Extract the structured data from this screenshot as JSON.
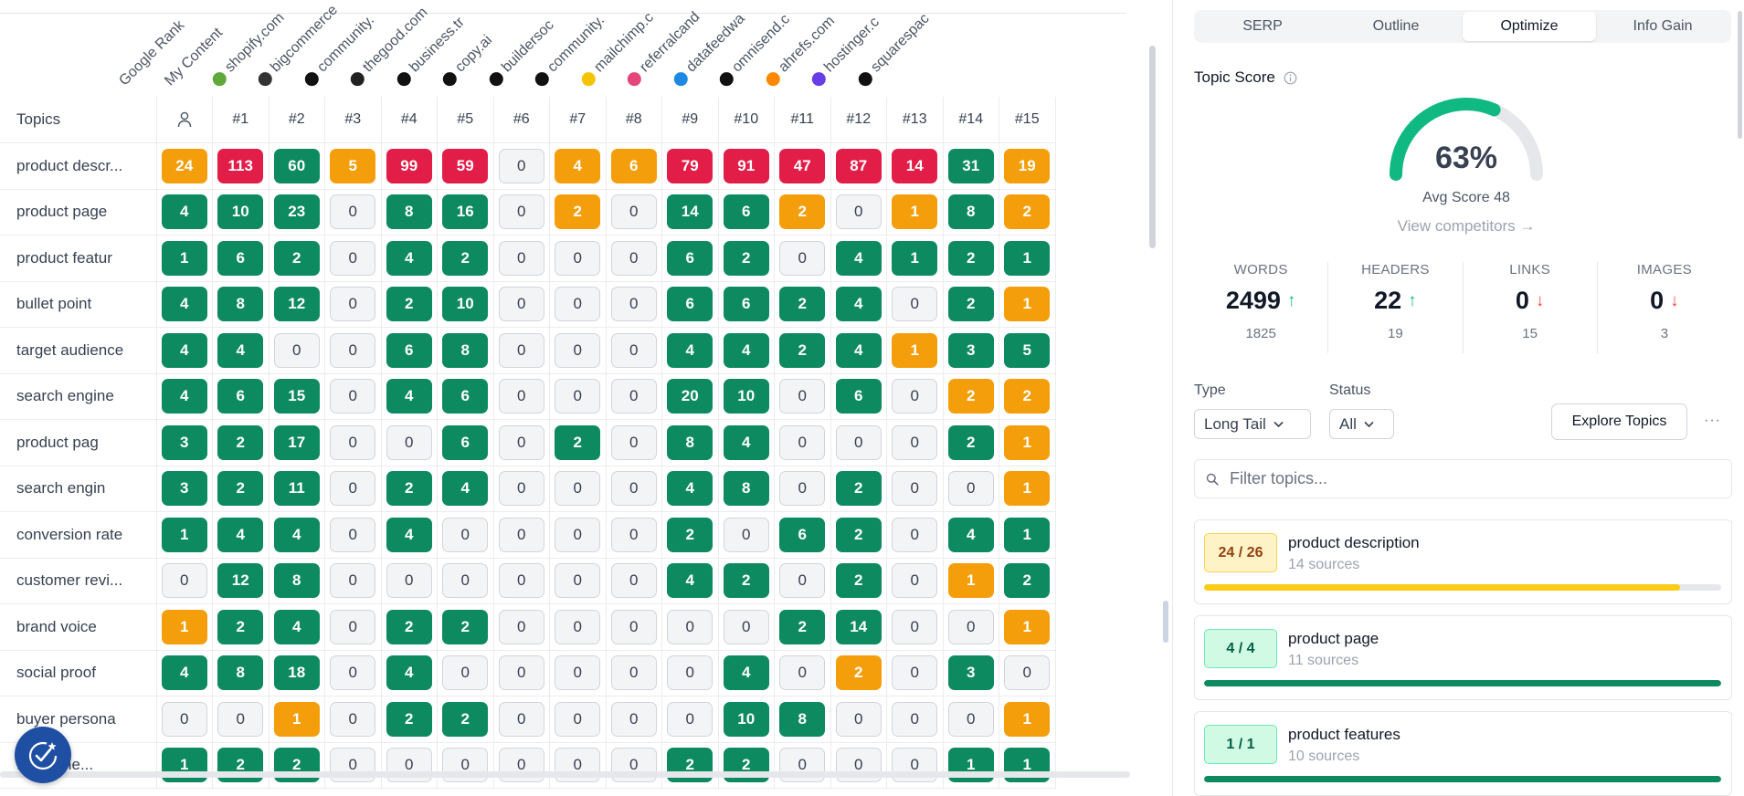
{
  "colors": {
    "green": "#0d8a5f",
    "red": "#e11d48",
    "orange": "#f59e0b",
    "zero_bg": "#f3f4f6",
    "gauge": "#10b981",
    "accent_blue": "#1e4fa3"
  },
  "heatmap": {
    "column_headers": [
      {
        "label": "Google Rank",
        "icon": "none",
        "color": ""
      },
      {
        "label": "My Content",
        "icon": "none",
        "color": ""
      },
      {
        "label": "shopify.com",
        "icon": "shopify-favicon-icon",
        "color": "#5fa83a"
      },
      {
        "label": "bigcommerce",
        "icon": "bigcommerce-favicon-icon",
        "color": "#333333"
      },
      {
        "label": "community.",
        "icon": "community-favicon-icon",
        "color": "#111111"
      },
      {
        "label": "thegood.com",
        "icon": "thegood-favicon-icon",
        "color": "#222222"
      },
      {
        "label": "business.tr",
        "icon": "business-favicon-icon",
        "color": "#111111"
      },
      {
        "label": "copy.ai",
        "icon": "copyai-favicon-icon",
        "color": "#111111"
      },
      {
        "label": "buildersoc",
        "icon": "builder-favicon-icon",
        "color": "#111111"
      },
      {
        "label": "community.",
        "icon": "community-favicon-icon",
        "color": "#111111"
      },
      {
        "label": "mailchimp.c",
        "icon": "mailchimp-favicon-icon",
        "color": "#f5c400"
      },
      {
        "label": "referralcand",
        "icon": "referral-favicon-icon",
        "color": "#e5467a"
      },
      {
        "label": "datafeedwa",
        "icon": "datafeed-favicon-icon",
        "color": "#1e88e5"
      },
      {
        "label": "omnisend.c",
        "icon": "omnisend-favicon-icon",
        "color": "#111111"
      },
      {
        "label": "ahrefs.com",
        "icon": "ahrefs-favicon-icon",
        "color": "#ff8800"
      },
      {
        "label": "hostinger.c",
        "icon": "hostinger-favicon-icon",
        "color": "#673de6"
      },
      {
        "label": "squarespac",
        "icon": "squarespace-favicon-icon",
        "color": "#111111"
      }
    ],
    "topics_header": "Topics",
    "rank_headers": [
      "#1",
      "#2",
      "#3",
      "#4",
      "#5",
      "#6",
      "#7",
      "#8",
      "#9",
      "#10",
      "#11",
      "#12",
      "#13",
      "#14",
      "#15"
    ],
    "rows": [
      {
        "topic": "product descr...",
        "values": [
          24,
          113,
          60,
          5,
          99,
          59,
          0,
          4,
          6,
          79,
          91,
          47,
          87,
          14,
          31,
          19
        ],
        "status": [
          "o",
          "r",
          "g",
          "o",
          "r",
          "r",
          "z",
          "o",
          "o",
          "r",
          "r",
          "r",
          "r",
          "r",
          "g",
          "o"
        ]
      },
      {
        "topic": "product page",
        "values": [
          4,
          10,
          23,
          0,
          8,
          16,
          0,
          2,
          0,
          14,
          6,
          2,
          0,
          1,
          8,
          2
        ],
        "status": [
          "g",
          "g",
          "g",
          "z",
          "g",
          "g",
          "z",
          "o",
          "z",
          "g",
          "g",
          "o",
          "z",
          "o",
          "g",
          "o"
        ]
      },
      {
        "topic": "product featur",
        "values": [
          1,
          6,
          2,
          0,
          4,
          2,
          0,
          0,
          0,
          6,
          2,
          0,
          4,
          1,
          2,
          1
        ],
        "status": [
          "g",
          "g",
          "g",
          "z",
          "g",
          "g",
          "z",
          "z",
          "z",
          "g",
          "g",
          "z",
          "g",
          "g",
          "g",
          "g"
        ]
      },
      {
        "topic": "bullet point",
        "values": [
          4,
          8,
          12,
          0,
          2,
          10,
          0,
          0,
          0,
          6,
          6,
          2,
          4,
          0,
          2,
          1
        ],
        "status": [
          "g",
          "g",
          "g",
          "z",
          "g",
          "g",
          "z",
          "z",
          "z",
          "g",
          "g",
          "g",
          "g",
          "z",
          "g",
          "o"
        ]
      },
      {
        "topic": "target audience",
        "values": [
          4,
          4,
          0,
          0,
          6,
          8,
          0,
          0,
          0,
          4,
          4,
          2,
          4,
          1,
          3,
          5
        ],
        "status": [
          "g",
          "g",
          "z",
          "z",
          "g",
          "g",
          "z",
          "z",
          "z",
          "g",
          "g",
          "g",
          "g",
          "o",
          "g",
          "g"
        ]
      },
      {
        "topic": "search engine",
        "values": [
          4,
          6,
          15,
          0,
          4,
          6,
          0,
          0,
          0,
          20,
          10,
          0,
          6,
          0,
          2,
          2
        ],
        "status": [
          "g",
          "g",
          "g",
          "z",
          "g",
          "g",
          "z",
          "z",
          "z",
          "g",
          "g",
          "z",
          "g",
          "z",
          "o",
          "o"
        ]
      },
      {
        "topic": "product pag",
        "values": [
          3,
          2,
          17,
          0,
          0,
          6,
          0,
          2,
          0,
          8,
          4,
          0,
          0,
          0,
          2,
          1
        ],
        "status": [
          "g",
          "g",
          "g",
          "z",
          "z",
          "g",
          "z",
          "g",
          "z",
          "g",
          "g",
          "z",
          "z",
          "z",
          "g",
          "o"
        ]
      },
      {
        "topic": "search engin",
        "values": [
          3,
          2,
          11,
          0,
          2,
          4,
          0,
          0,
          0,
          4,
          8,
          0,
          2,
          0,
          0,
          1
        ],
        "status": [
          "g",
          "g",
          "g",
          "z",
          "g",
          "g",
          "z",
          "z",
          "z",
          "g",
          "g",
          "z",
          "g",
          "z",
          "z",
          "o"
        ]
      },
      {
        "topic": "conversion rate",
        "values": [
          1,
          4,
          4,
          0,
          4,
          0,
          0,
          0,
          0,
          2,
          0,
          6,
          2,
          0,
          4,
          1
        ],
        "status": [
          "g",
          "g",
          "g",
          "z",
          "g",
          "z",
          "z",
          "z",
          "z",
          "g",
          "z",
          "g",
          "g",
          "z",
          "g",
          "g"
        ]
      },
      {
        "topic": "customer revi...",
        "values": [
          0,
          12,
          8,
          0,
          0,
          0,
          0,
          0,
          0,
          4,
          2,
          0,
          2,
          0,
          1,
          2
        ],
        "status": [
          "z",
          "g",
          "g",
          "z",
          "z",
          "z",
          "z",
          "z",
          "z",
          "g",
          "g",
          "z",
          "g",
          "z",
          "o",
          "g"
        ]
      },
      {
        "topic": "brand voice",
        "values": [
          1,
          2,
          4,
          0,
          2,
          2,
          0,
          0,
          0,
          0,
          0,
          2,
          14,
          0,
          0,
          1
        ],
        "status": [
          "o",
          "g",
          "g",
          "z",
          "g",
          "g",
          "z",
          "z",
          "z",
          "z",
          "z",
          "g",
          "g",
          "z",
          "z",
          "o"
        ]
      },
      {
        "topic": "social proof",
        "values": [
          4,
          8,
          18,
          0,
          4,
          0,
          0,
          0,
          0,
          0,
          4,
          0,
          2,
          0,
          3,
          0
        ],
        "status": [
          "g",
          "g",
          "g",
          "z",
          "g",
          "z",
          "z",
          "z",
          "z",
          "z",
          "g",
          "z",
          "o",
          "z",
          "g",
          "z"
        ]
      },
      {
        "topic": "buyer persona",
        "values": [
          0,
          0,
          1,
          0,
          2,
          2,
          0,
          0,
          0,
          0,
          10,
          8,
          0,
          0,
          0,
          1
        ],
        "status": [
          "z",
          "z",
          "o",
          "z",
          "g",
          "g",
          "z",
          "z",
          "z",
          "z",
          "g",
          "g",
          "z",
          "z",
          "z",
          "o"
        ]
      },
      {
        "topic": "... engine...",
        "values": [
          1,
          2,
          2,
          0,
          0,
          0,
          0,
          0,
          0,
          2,
          2,
          0,
          0,
          0,
          1,
          1
        ],
        "status": [
          "g",
          "g",
          "g",
          "z",
          "z",
          "z",
          "z",
          "z",
          "z",
          "g",
          "g",
          "z",
          "z",
          "z",
          "g",
          "g"
        ]
      }
    ]
  },
  "panel": {
    "tabs": [
      {
        "label": "SERP",
        "active": false
      },
      {
        "label": "Outline",
        "active": false
      },
      {
        "label": "Optimize",
        "active": true
      },
      {
        "label": "Info Gain",
        "active": false
      }
    ],
    "topic_score_label": "Topic Score",
    "score_percent": "63%",
    "score_value": 63,
    "avg_score": "Avg Score 48",
    "view_competitors": "View competitors →",
    "stats": [
      {
        "label": "WORDS",
        "value": "2499",
        "trend": "up",
        "sub": "1825"
      },
      {
        "label": "HEADERS",
        "value": "22",
        "trend": "up",
        "sub": "19"
      },
      {
        "label": "LINKS",
        "value": "0",
        "trend": "down",
        "sub": "15"
      },
      {
        "label": "IMAGES",
        "value": "0",
        "trend": "down",
        "sub": "3"
      }
    ],
    "type_label": "Type",
    "type_value": "Long Tail",
    "status_label": "Status",
    "status_value": "All",
    "explore_topics": "Explore Topics",
    "more_label": "···",
    "filter_placeholder": "Filter topics...",
    "topics": [
      {
        "badge": "24 / 26",
        "title": "product description",
        "sources": "14 sources",
        "progress": 0.92,
        "badge_bg": "#fef3c7",
        "badge_border": "#fcd34d",
        "badge_color": "#92400e",
        "bar_color": "#facc15"
      },
      {
        "badge": "4 / 4",
        "title": "product page",
        "sources": "11 sources",
        "progress": 1.0,
        "badge_bg": "#d1fae5",
        "badge_border": "#6ee7b7",
        "badge_color": "#065f46",
        "bar_color": "#0d8a5f"
      },
      {
        "badge": "1 / 1",
        "title": "product features",
        "sources": "10 sources",
        "progress": 1.0,
        "badge_bg": "#d1fae5",
        "badge_border": "#6ee7b7",
        "badge_color": "#065f46",
        "bar_color": "#0d8a5f"
      }
    ]
  }
}
